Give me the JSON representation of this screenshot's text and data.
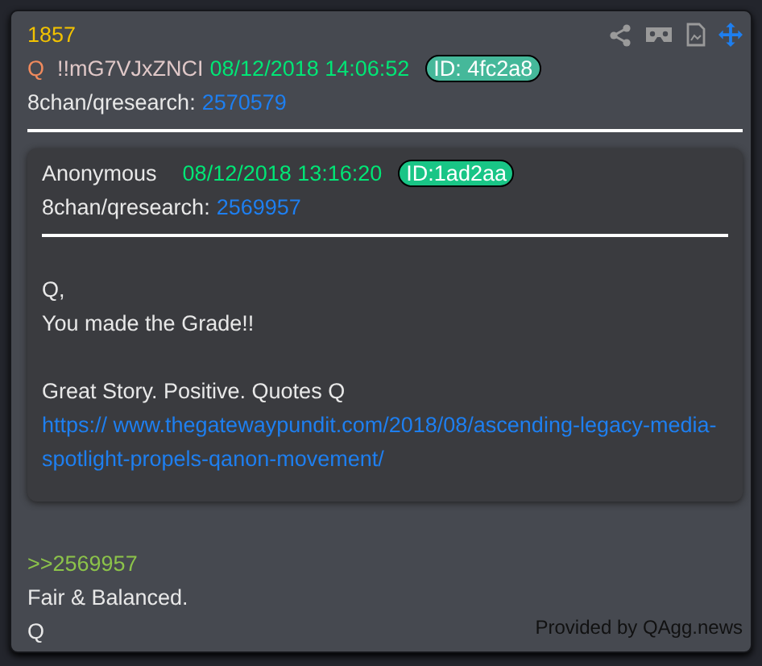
{
  "post": {
    "number": "1857",
    "author_mark": "Q",
    "tripcode": "!!mG7VJxZNCI",
    "timestamp": "08/12/2018 14:06:52",
    "id_badge": "ID: 4fc2a8",
    "board": "8chan/qresearch:",
    "post_link": "2570579"
  },
  "quote": {
    "author": "Anonymous",
    "timestamp": "08/12/2018 13:16:20",
    "id_badge": "ID:1ad2aa",
    "board": "8chan/qresearch:",
    "post_link": "2569957",
    "lines": [
      {
        "kind": "text",
        "text": "Q,"
      },
      {
        "kind": "text",
        "text": "You made the Grade!!"
      },
      {
        "kind": "blank"
      },
      {
        "kind": "text",
        "text": "Great Story. Positive. Quotes Q"
      },
      {
        "kind": "link",
        "text": "https:// www.thegatewaypundit.com/2018/08/ascending-legacy-media-spotlight-propels-qanon-movement/"
      }
    ]
  },
  "body": [
    {
      "kind": "reply_link",
      "text": ">>2569957"
    },
    {
      "kind": "text",
      "text": "Fair & Balanced."
    },
    {
      "kind": "text",
      "text": "Q"
    }
  ],
  "footer": "Provided by QAgg.news"
}
